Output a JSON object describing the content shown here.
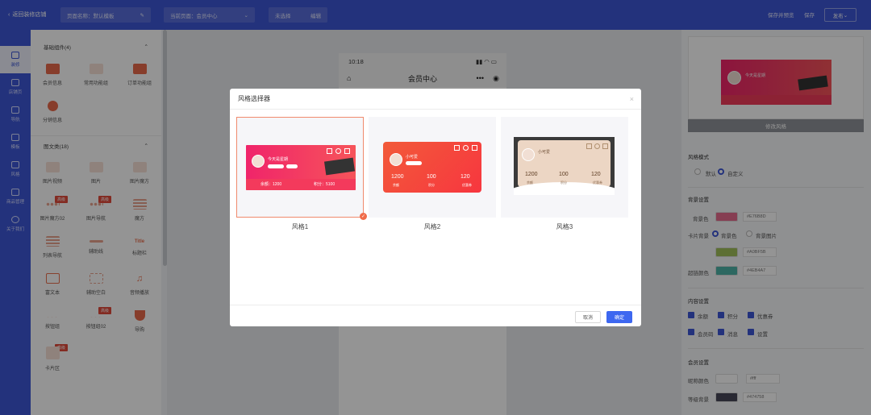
{
  "topbar": {
    "back_label": "返回装修店铺",
    "page_name": "页面名称：默认模板",
    "current_page": "当前页面：会员中心",
    "unselected": "未选择",
    "edit": "编辑",
    "save_preview": "保存并预览",
    "save": "保存",
    "publish": "发布"
  },
  "leftnav": {
    "items": [
      {
        "label": "装修"
      },
      {
        "label": "店铺页"
      },
      {
        "label": "导航"
      },
      {
        "label": "模板"
      },
      {
        "label": "风格"
      },
      {
        "label": "商品管理"
      },
      {
        "label": "关于我们"
      }
    ]
  },
  "panel": {
    "basic_section": "基础组件(4)",
    "basic_items": [
      {
        "label": "会员信息"
      },
      {
        "label": "常用功能组"
      },
      {
        "label": "订单功能组"
      },
      {
        "label": "分销信息"
      }
    ],
    "graphic_section": "图文类(18)",
    "graphic_items": [
      {
        "label": "图片视频",
        "tag": ""
      },
      {
        "label": "图片",
        "tag": ""
      },
      {
        "label": "图片魔方",
        "tag": ""
      },
      {
        "label": "图片魔方02",
        "tag": "高级"
      },
      {
        "label": "图片导航",
        "tag": "高级"
      },
      {
        "label": "魔方",
        "tag": ""
      },
      {
        "label": "列表导航",
        "tag": ""
      },
      {
        "label": "辅助线",
        "tag": ""
      },
      {
        "label": "标题栏",
        "tag": ""
      },
      {
        "label": "富文本",
        "tag": ""
      },
      {
        "label": "辅助空白",
        "tag": ""
      },
      {
        "label": "音频播放",
        "tag": ""
      },
      {
        "label": "按钮组",
        "tag": ""
      },
      {
        "label": "按钮组02",
        "tag": "高级"
      },
      {
        "label": "导购",
        "tag": ""
      },
      {
        "label": "卡片区",
        "tag": "高级"
      }
    ],
    "title_icon_text": "Title"
  },
  "phone": {
    "time": "10:18",
    "title": "会员中心"
  },
  "right_panel": {
    "modify_style": "修改风格",
    "style_mode_title": "风格模式",
    "mode_default": "默认",
    "mode_custom": "自定义",
    "bg_section": "背景设置",
    "bg_color_label": "背景色",
    "bg_color_hex": "#E76B8D",
    "card_bg_label": "卡片背景",
    "card_bg_color": "背景色",
    "card_bg_image": "背景图片",
    "card_bg_hex": "#A0BF5B",
    "accent_label": "超链颜色",
    "accent_hex": "#4EB4A7",
    "content_section": "内容设置",
    "content_items": [
      "余额",
      "积分",
      "优惠券",
      "会员码",
      "消息",
      "设置"
    ],
    "member_section": "会员设置",
    "name_color_label": "昵称颜色",
    "name_color_hex": "#fff",
    "level_color_label": "等级背景",
    "level_color_hex": "#474758"
  },
  "modal": {
    "title": "风格选择器",
    "close": "×",
    "cancel": "取消",
    "confirm": "确定",
    "styles": [
      {
        "name": "风格1",
        "selected": true
      },
      {
        "name": "风格2",
        "selected": false
      },
      {
        "name": "风格3",
        "selected": false
      }
    ],
    "card1": {
      "nickname": "今天是星期",
      "balance": "余额：1200",
      "points": "积分：5100"
    },
    "card2": {
      "nickname": "小可爱",
      "stats": [
        "1200",
        "100",
        "120"
      ],
      "stat_labels": [
        "余额",
        "积分",
        "优惠券"
      ]
    },
    "card3": {
      "nickname": "小可爱",
      "stats": [
        "1200",
        "100",
        "120"
      ],
      "stat_labels": [
        "余额",
        "积分",
        "优惠券"
      ]
    }
  },
  "colors": {
    "brand": "#3d56d6",
    "confirm": "#3d67f0",
    "selected_border": "#f08a6d",
    "card1_gradient": [
      "#f0246a",
      "#f6545a"
    ],
    "card2_gradient": [
      "#f25a3a",
      "#f7363f"
    ]
  }
}
